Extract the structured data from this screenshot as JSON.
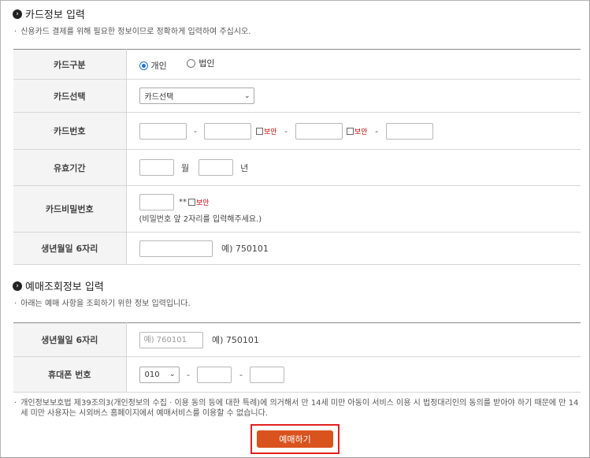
{
  "card_section": {
    "title": "카드정보 입력",
    "note": "신용카드 결제를 위해 필요한 정보이므로 정확하게 입력하여 주십시오.",
    "rows": {
      "card_type": {
        "label": "카드구분",
        "options": [
          "개인",
          "법인"
        ],
        "selected": "개인"
      },
      "card_select": {
        "label": "카드선택",
        "value": "카드선택"
      },
      "card_number": {
        "label": "카드번호",
        "dash": "-",
        "secure": "보안"
      },
      "expiry": {
        "label": "유효기간",
        "month_unit": "월",
        "year_unit": "년"
      },
      "password": {
        "label": "카드비밀번호",
        "masked": "**",
        "secure": "보안",
        "hint": "(비밀번호 앞 2자리를 입력해주세요.)"
      },
      "birth": {
        "label": "생년월일 6자리",
        "example": "예) 750101"
      }
    }
  },
  "lookup_section": {
    "title": "예매조회정보 입력",
    "note": "아래는 예매 사항을 조회하기 위한 정보 입력입니다.",
    "rows": {
      "birth": {
        "label": "생년월일 6자리",
        "placeholder": "예) 760101",
        "example": "예) 750101"
      },
      "phone": {
        "label": "휴대폰 번호",
        "prefix": "010",
        "dash": "-"
      }
    }
  },
  "bottom_note": "개인정보보호법 제39조의3(개인정보의 수집 · 이용 동의 등에 대한 특례)에 의거해서 만 14세 미만 아동이 서비스 이용 시 법정대리인의 동의를 받아야 하기 때문에 만 14세 미만 사용자는 시외버스 홈페이지에서 예매서비스를 이용할 수 없습니다.",
  "reserve_button": "예매하기",
  "colors": {
    "accent": "#d9531e",
    "highlight_border": "#e02020",
    "secure": "#cc0000",
    "radio": "#1a73e8"
  }
}
